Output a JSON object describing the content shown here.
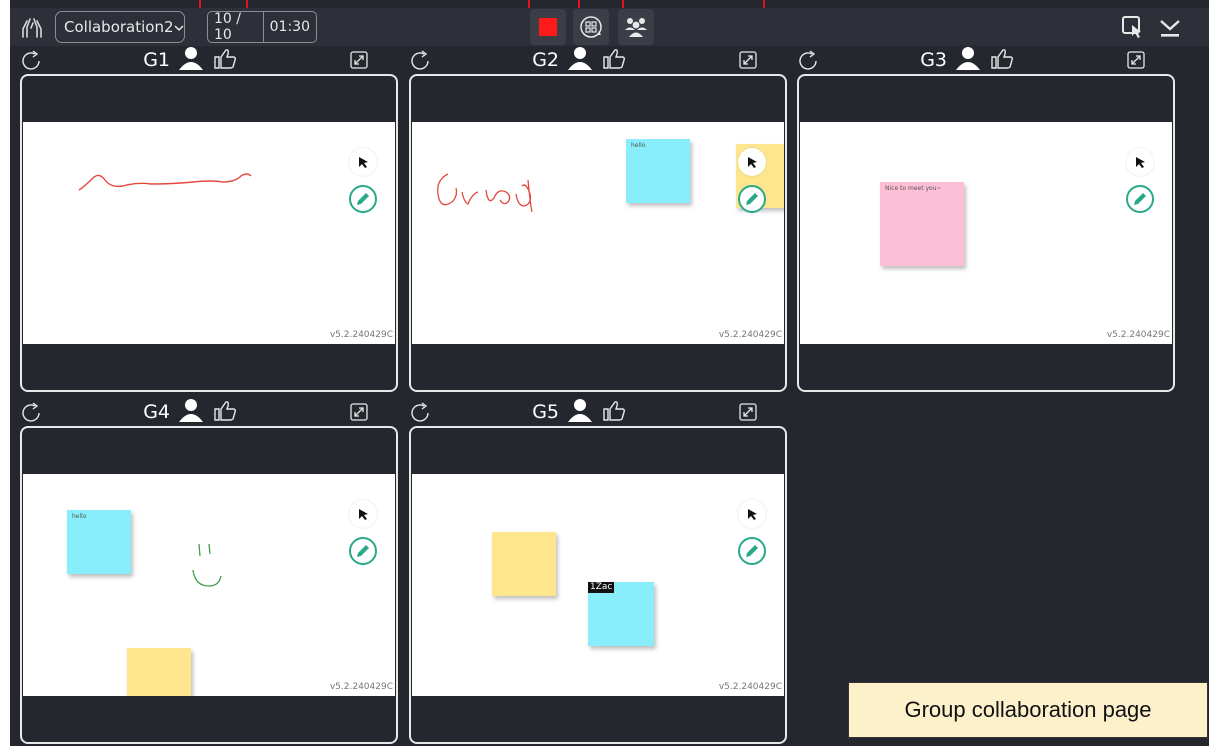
{
  "toolbar": {
    "session_name": "Collaboration2",
    "counter_current": "10 / 10",
    "timer": "01:30",
    "icons": {
      "hands": "raise-hands-icon",
      "stop": "stop-square-icon",
      "rotate": "rotate-groups-icon",
      "groups": "group-people-icon",
      "select_window": "select-window-icon",
      "download": "download-icon"
    },
    "stop_color": "#ff1a1a"
  },
  "groups": [
    {
      "name": "G1",
      "version": "v5.2.240429C"
    },
    {
      "name": "G2",
      "version": "v5.2.240429C",
      "notes": [
        "hello"
      ]
    },
    {
      "name": "G3",
      "version": "v5.2.240429C",
      "notes": [
        "Nice to meet you~"
      ]
    },
    {
      "name": "G4",
      "version": "v5.2.240429C",
      "notes": [
        "hello"
      ]
    },
    {
      "name": "G5",
      "version": "v5.2.240429C",
      "tag": "1Zac"
    }
  ],
  "caption": "Group collaboration page",
  "colors": {
    "background": "#24272e",
    "note_cyan": "#88eefc",
    "note_yellow": "#fde68e",
    "note_pink": "#fdbfd6",
    "accent_pen": "#2aa88a",
    "annotation": "#e0141e"
  }
}
